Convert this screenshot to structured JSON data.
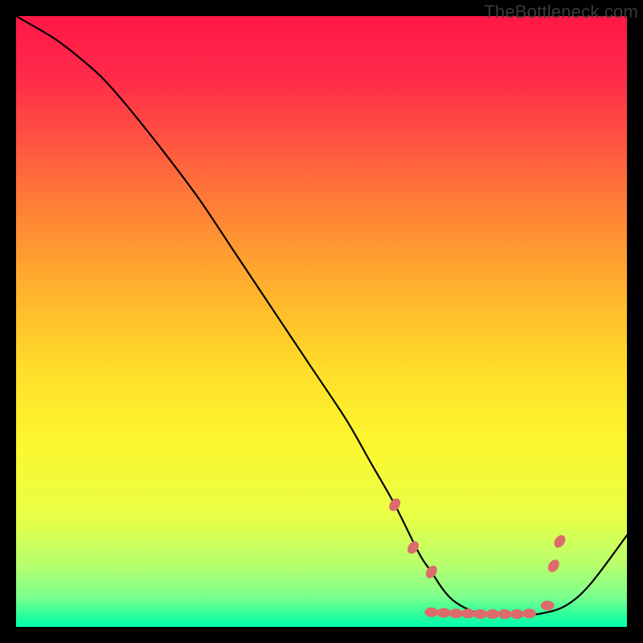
{
  "watermark": "TheBottleneck.com",
  "chart_data": {
    "type": "line",
    "title": "",
    "xlabel": "",
    "ylabel": "",
    "xlim": [
      0,
      100
    ],
    "ylim": [
      0,
      100
    ],
    "series": [
      {
        "name": "curve",
        "x": [
          0,
          6,
          10,
          14,
          18,
          24,
          30,
          36,
          42,
          48,
          54,
          58,
          62,
          66,
          68,
          70,
          72,
          75,
          78,
          80,
          83,
          86,
          90,
          94,
          100
        ],
        "y": [
          100,
          96.5,
          93.5,
          90,
          85.5,
          78,
          70,
          61,
          52,
          43,
          34,
          27,
          20,
          12,
          9,
          6,
          4,
          2.5,
          2,
          2,
          2,
          2.2,
          3.5,
          7,
          15
        ]
      }
    ],
    "markers": [
      {
        "x": 62,
        "y": 20
      },
      {
        "x": 65,
        "y": 13
      },
      {
        "x": 68,
        "y": 9
      },
      {
        "x": 68,
        "y": 2.4
      },
      {
        "x": 70,
        "y": 2.3
      },
      {
        "x": 72,
        "y": 2.2
      },
      {
        "x": 74,
        "y": 2.2
      },
      {
        "x": 76,
        "y": 2.1
      },
      {
        "x": 78,
        "y": 2.1
      },
      {
        "x": 80,
        "y": 2.1
      },
      {
        "x": 82,
        "y": 2.1
      },
      {
        "x": 84,
        "y": 2.2
      },
      {
        "x": 87,
        "y": 3.5
      },
      {
        "x": 88,
        "y": 10
      },
      {
        "x": 89,
        "y": 14
      }
    ]
  }
}
